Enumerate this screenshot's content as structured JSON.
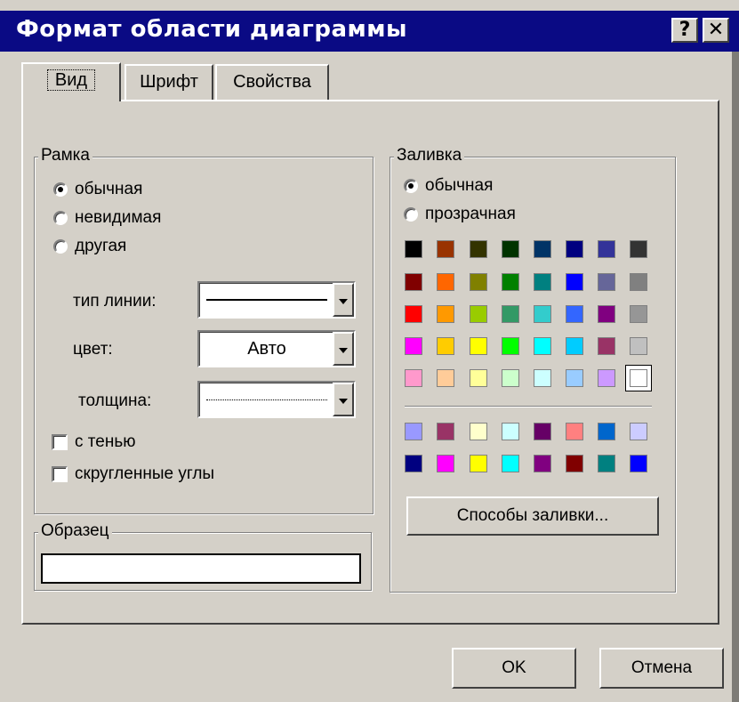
{
  "window": {
    "title": "Формат области диаграммы",
    "help_label": "?",
    "close_label": "✕"
  },
  "tabs": [
    {
      "label": "Вид",
      "active": true
    },
    {
      "label": "Шрифт",
      "active": false
    },
    {
      "label": "Свойства",
      "active": false
    }
  ],
  "frame": {
    "legend": "Рамка",
    "options": [
      {
        "label": "обычная",
        "selected": true
      },
      {
        "label": "невидимая",
        "selected": false
      },
      {
        "label": "другая",
        "selected": false
      }
    ],
    "line_type_label": "тип линии:",
    "color_label": "цвет:",
    "color_value": "Авто",
    "thickness_label": "толщина:",
    "shadow_label": "с тенью",
    "rounded_label": "скругленные углы"
  },
  "sample": {
    "legend": "Образец"
  },
  "fill": {
    "legend": "Заливка",
    "options": [
      {
        "label": "обычная",
        "selected": true
      },
      {
        "label": "прозрачная",
        "selected": false
      }
    ],
    "palette_main": [
      [
        "#000000",
        "#993300",
        "#333300",
        "#003300",
        "#003366",
        "#000080",
        "#333399",
        "#333333"
      ],
      [
        "#800000",
        "#ff6600",
        "#808000",
        "#008000",
        "#008080",
        "#0000ff",
        "#666699",
        "#808080"
      ],
      [
        "#ff0000",
        "#ff9900",
        "#99cc00",
        "#339966",
        "#33cccc",
        "#3366ff",
        "#800080",
        "#969696"
      ],
      [
        "#ff00ff",
        "#ffcc00",
        "#ffff00",
        "#00ff00",
        "#00ffff",
        "#00ccff",
        "#993366",
        "#c0c0c0"
      ],
      [
        "#ff99cc",
        "#ffcc99",
        "#ffff99",
        "#ccffcc",
        "#ccffff",
        "#99ccff",
        "#cc99ff",
        "#ffffff"
      ]
    ],
    "palette_extra": [
      [
        "#9999ff",
        "#993366",
        "#ffffcc",
        "#ccffff",
        "#660066",
        "#ff8080",
        "#0066cc",
        "#ccccff"
      ],
      [
        "#000080",
        "#ff00ff",
        "#ffff00",
        "#00ffff",
        "#800080",
        "#800000",
        "#008080",
        "#0000ff"
      ]
    ],
    "fill_effects_label": "Способы заливки..."
  },
  "buttons": {
    "ok": "OK",
    "cancel": "Отмена"
  }
}
